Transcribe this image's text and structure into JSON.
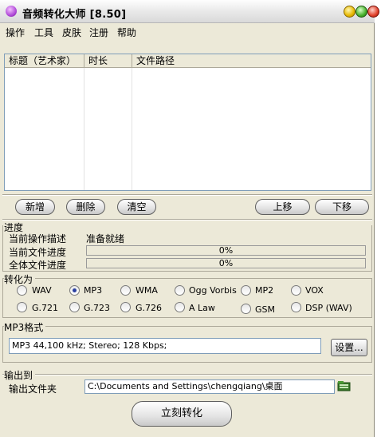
{
  "window": {
    "title": "音频转化大师 [8.50]"
  },
  "menu": [
    "操作",
    "工具",
    "皮肤",
    "注册",
    "帮助"
  ],
  "file_list": {
    "columns": [
      "标题（艺术家）",
      "时长",
      "文件路径"
    ],
    "rows": []
  },
  "list_buttons": {
    "add": "新增",
    "delete": "删除",
    "clear": "清空",
    "up": "上移",
    "down": "下移"
  },
  "progress": {
    "section": "进度",
    "desc_label": "当前操作描述",
    "desc_value": "准备就绪",
    "file_label": "当前文件进度",
    "file_pct": "0%",
    "all_label": "全体文件进度",
    "all_pct": "0%"
  },
  "convert_to": {
    "section": "转化为",
    "formats": [
      "WAV",
      "MP3",
      "WMA",
      "Ogg Vorbis",
      "MP2",
      "VOX",
      "G.721",
      "G.723",
      "G.726",
      "A Law",
      "GSM",
      "DSP (WAV)"
    ],
    "selected": "MP3"
  },
  "mp3_format": {
    "section": "MP3格式",
    "value": "MP3 44,100 kHz; Stereo;  128 Kbps;",
    "settings_button": "设置..."
  },
  "output": {
    "section": "输出到",
    "label": "输出文件夹",
    "path": "C:\\Documents and Settings\\chengqiang\\桌面"
  },
  "convert_button": "立刻转化",
  "colors": {
    "window_bg": "#ece9d8",
    "radio_dot": "#2a3fa0",
    "border": "#aca899"
  }
}
